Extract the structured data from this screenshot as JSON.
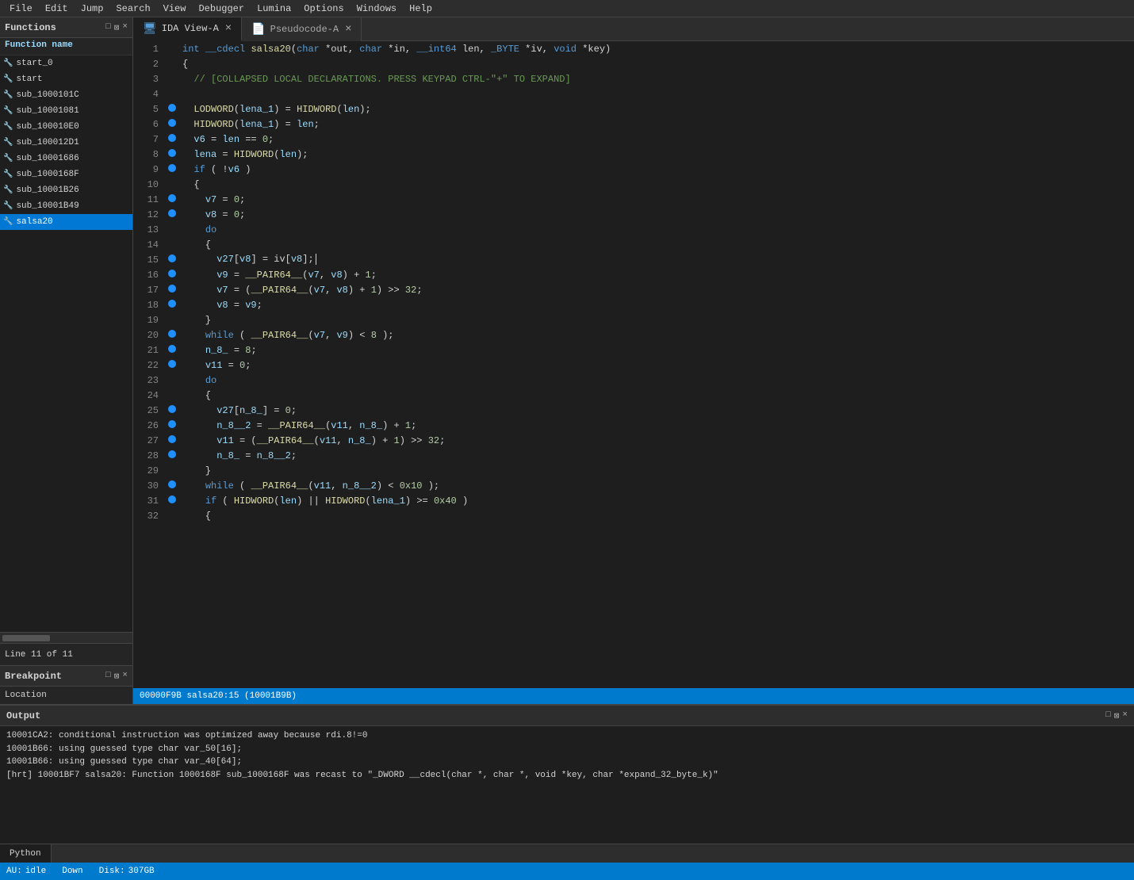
{
  "menu": {
    "items": [
      "File",
      "Edit",
      "Jump",
      "Search",
      "View",
      "Debugger",
      "Lumina",
      "Options",
      "Windows",
      "Help"
    ]
  },
  "functions_panel": {
    "title": "Functions",
    "header_label": "Function name",
    "icons": [
      "□",
      "×",
      "−"
    ],
    "items": [
      {
        "name": "start_0",
        "selected": false
      },
      {
        "name": "start",
        "selected": false
      },
      {
        "name": "sub_1000101C",
        "selected": false
      },
      {
        "name": "sub_10001081",
        "selected": false
      },
      {
        "name": "sub_100010E0",
        "selected": false
      },
      {
        "name": "sub_100012D1",
        "selected": false
      },
      {
        "name": "sub_10001686",
        "selected": false
      },
      {
        "name": "sub_1000168F",
        "selected": false
      },
      {
        "name": "sub_10001B26",
        "selected": false
      },
      {
        "name": "sub_10001B49",
        "selected": false
      },
      {
        "name": "salsa20",
        "selected": true
      }
    ]
  },
  "line_info": {
    "label": "Line 11 of 11"
  },
  "breakpoint_panel": {
    "title": "Breakpoint",
    "icons": [
      "□",
      "×",
      "−"
    ]
  },
  "location_section": {
    "label": "Location"
  },
  "tabs": {
    "left_tab": {
      "label": "IDA View-A",
      "icon": "🖥"
    },
    "right_tab": {
      "label": "Pseudocode-A",
      "icon": "📄"
    }
  },
  "code": {
    "lines": [
      {
        "num": 1,
        "bp": false,
        "content": "int __cdecl salsa20(char *out, char *in, __int64 len, _BYTE *iv, void *key)"
      },
      {
        "num": 2,
        "bp": false,
        "content": "{"
      },
      {
        "num": 3,
        "bp": false,
        "content": "  // [COLLAPSED LOCAL DECLARATIONS. PRESS KEYPAD CTRL-\"+\" TO EXPAND]"
      },
      {
        "num": 4,
        "bp": false,
        "content": ""
      },
      {
        "num": 5,
        "bp": true,
        "content": "  LODWORD(lena_1) = HIDWORD(len);"
      },
      {
        "num": 6,
        "bp": true,
        "content": "  HIDWORD(lena_1) = len;"
      },
      {
        "num": 7,
        "bp": true,
        "content": "  v6 = len == 0;"
      },
      {
        "num": 8,
        "bp": true,
        "content": "  lena = HIDWORD(len);"
      },
      {
        "num": 9,
        "bp": true,
        "content": "  if ( !v6 )"
      },
      {
        "num": 10,
        "bp": false,
        "content": "  {"
      },
      {
        "num": 11,
        "bp": true,
        "content": "    v7 = 0;"
      },
      {
        "num": 12,
        "bp": true,
        "content": "    v8 = 0;"
      },
      {
        "num": 13,
        "bp": false,
        "content": "    do"
      },
      {
        "num": 14,
        "bp": false,
        "content": "    {"
      },
      {
        "num": 15,
        "bp": true,
        "content": "      v27[v8] = iv[v8];"
      },
      {
        "num": 16,
        "bp": true,
        "content": "      v9 = __PAIR64__(v7, v8) + 1;"
      },
      {
        "num": 17,
        "bp": true,
        "content": "      v7 = (__PAIR64__(v7, v8) + 1) >> 32;"
      },
      {
        "num": 18,
        "bp": true,
        "content": "      v8 = v9;"
      },
      {
        "num": 19,
        "bp": false,
        "content": "    }"
      },
      {
        "num": 20,
        "bp": true,
        "content": "    while ( __PAIR64__(v7, v9) < 8 );"
      },
      {
        "num": 21,
        "bp": true,
        "content": "    n_8_ = 8;"
      },
      {
        "num": 22,
        "bp": true,
        "content": "    v11 = 0;"
      },
      {
        "num": 23,
        "bp": false,
        "content": "    do"
      },
      {
        "num": 24,
        "bp": false,
        "content": "    {"
      },
      {
        "num": 25,
        "bp": true,
        "content": "      v27[n_8_] = 0;"
      },
      {
        "num": 26,
        "bp": true,
        "content": "      n_8__2 = __PAIR64__(v11, n_8_) + 1;"
      },
      {
        "num": 27,
        "bp": true,
        "content": "      v11 = (__PAIR64__(v11, n_8_) + 1) >> 32;"
      },
      {
        "num": 28,
        "bp": true,
        "content": "      n_8_ = n_8__2;"
      },
      {
        "num": 29,
        "bp": false,
        "content": "    }"
      },
      {
        "num": 30,
        "bp": true,
        "content": "    while ( __PAIR64__(v11, n_8__2) < 0x10 );"
      },
      {
        "num": 31,
        "bp": true,
        "content": "    if ( HIDWORD(len) || HIDWORD(lena_1) >= 0x40 )"
      },
      {
        "num": 32,
        "bp": false,
        "content": "    {"
      }
    ]
  },
  "code_status": {
    "text": "00000F9B salsa20:15 (10001B9B)"
  },
  "output_panel": {
    "title": "Output",
    "icons": [
      "□",
      "×",
      "−"
    ],
    "lines": [
      "10001CA2: conditional instruction was optimized away because rdi.8!=0",
      "10001B66: using guessed type char var_50[16];",
      "10001B66: using guessed type char var_40[64];",
      "[hrt] 10001BF7 salsa20: Function 1000168F sub_1000168F was recast to \"_DWORD __cdecl(char *, char *, void *key, char *expand_32_byte_k)\""
    ]
  },
  "python_tab": {
    "label": "Python"
  },
  "status_bar": {
    "au_label": "AU:",
    "au_value": "idle",
    "down_label": "Down",
    "disk_label": "Disk:",
    "disk_value": "307GB"
  }
}
